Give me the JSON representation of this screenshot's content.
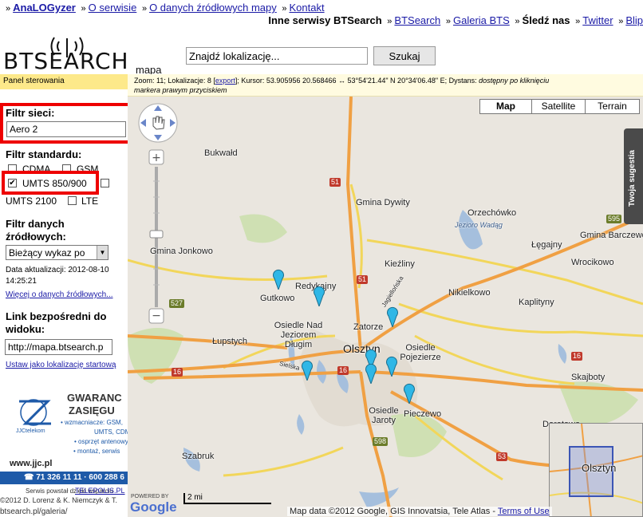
{
  "topnav": {
    "items": [
      "AnaLOGyzer",
      "O serwisie",
      "O danych źródłowych mapy",
      "Kontakt"
    ]
  },
  "subnav": {
    "label": "Inne serwisy BTSearch",
    "items": [
      "BTSearch",
      "Galeria BTS"
    ],
    "follow_label": "Śledź nas",
    "follow_items": [
      "Twitter",
      "Blip"
    ]
  },
  "logo": {
    "text": "BTSEARCH",
    "subtext": "mapa"
  },
  "search": {
    "placeholder": "Znajdź lokalizację...",
    "button": "Szukaj"
  },
  "panel_header": "Panel sterowania",
  "status": {
    "line1_prefix": "Zoom: 11; Lokalizacje: 8 [",
    "export": "export",
    "line1_suffix": "]; Kursor: 53.905956 20.568466 ↔ 53°54'21.44\" N 20°34'06.48\" E; Dystans: ",
    "dist_note": "dostępny po kliknięciu",
    "line2": "markera prawym przyciskiem"
  },
  "sidebar": {
    "network_filter_label": "Filtr sieci:",
    "network_value": "Aero 2",
    "standard_filter_label": "Filtr standardu:",
    "standards": [
      {
        "label": "CDMA",
        "checked": false
      },
      {
        "label": "GSM",
        "checked": false
      },
      {
        "label": "UMTS 850/900",
        "checked": true
      },
      {
        "label": "UMTS 2100",
        "checked": false
      },
      {
        "label": "LTE",
        "checked": false
      }
    ],
    "source_filter_label_1": "Filtr danych",
    "source_filter_label_2": "źródłowych:",
    "source_value": "Bieżący wykaz po",
    "update_label": "Data aktualizacji: 2012-08-10",
    "update_time": "14:25:21",
    "more_link": "Więcej o danych źródłowych...",
    "direct_link_label_1": "Link bezpośredni do",
    "direct_link_label_2": "widoku:",
    "direct_link_value": "http://mapa.btsearch.p",
    "set_start_link": "Ustaw jako lokalizację startową"
  },
  "sponsor": {
    "brand": "JJCtelekom",
    "title_1": "GWARANC",
    "title_2": "ZASIĘGU",
    "bullets": [
      "• wzmacniacze: GSM,",
      "UMTS, CDMA",
      "• osprzęt antenowy",
      "• montaż, serwis"
    ],
    "url": "www.jjc.pl",
    "phone": "☎ 71 326 11 11 · 600 288 6",
    "thanks": "Serwis powstał dzięki wsparciu",
    "thanks_link": "TELEPOLIS.PL"
  },
  "footer": {
    "copyright": "©2012 D. Lorenz & K. Niemczyk & T.",
    "url": "btsearch.pl/galeria/"
  },
  "map": {
    "types": [
      "Map",
      "Satellite",
      "Terrain"
    ],
    "active_type": "Map",
    "feedback": "Twoja sugestia",
    "places": [
      {
        "name": "Bukwałd"
      },
      {
        "name": "Gmina Dywity"
      },
      {
        "name": "Orzechówko"
      },
      {
        "name": "Gmina Barczewo"
      },
      {
        "name": "Gmina Jonkowo"
      },
      {
        "name": "Jezioro Wadąg"
      },
      {
        "name": "Kieźliny"
      },
      {
        "name": "Łęgajny"
      },
      {
        "name": "Wrocikowo"
      },
      {
        "name": "Redykajny"
      },
      {
        "name": "Gutkowo"
      },
      {
        "name": "Nikielkowo"
      },
      {
        "name": "Kaplityny"
      },
      {
        "name": "Zatorze"
      },
      {
        "name": "Osiedle Nad Jeziorem Długim"
      },
      {
        "name": "Łupstych"
      },
      {
        "name": "Olsztyn"
      },
      {
        "name": "Osiedle Pojezierze"
      },
      {
        "name": "Skajboty"
      },
      {
        "name": "Osiedle Jaroty"
      },
      {
        "name": "Pieczewo"
      },
      {
        "name": "Szabruk"
      },
      {
        "name": "Dorotowo"
      },
      {
        "name": "Gutkowo"
      }
    ],
    "roads": [
      "51",
      "595",
      "527",
      "51",
      "16",
      "16",
      "16",
      "598",
      "53",
      "527"
    ],
    "street_labels": [
      "Jagiellońska",
      "Sielska"
    ],
    "overview_label": "Olsztyn",
    "attribution": "Map data ©2012 Google, GIS Innovatsia, Tele Atlas - ",
    "terms": "Terms of Use",
    "scale": "2 mi",
    "powered": "POWERED BY",
    "google": "Google"
  }
}
